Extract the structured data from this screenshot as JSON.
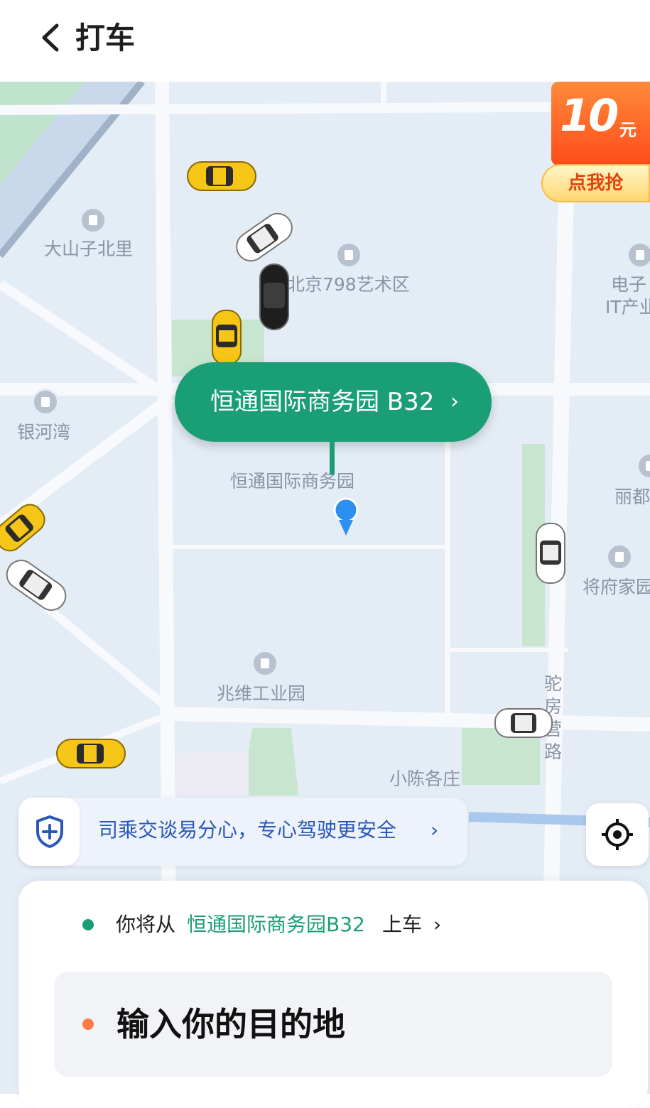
{
  "header": {
    "title": "打车",
    "back_icon": "chevron-left-icon"
  },
  "map": {
    "pois": [
      {
        "label": "大山子北里"
      },
      {
        "label": "北京798艺术区"
      },
      {
        "label": "电子"
      },
      {
        "label": "IT产业"
      },
      {
        "label": "银河湾"
      },
      {
        "label": "恒通国际商务园"
      },
      {
        "label": "丽都"
      },
      {
        "label": "将府家园"
      },
      {
        "label": "兆维工业园"
      },
      {
        "label": "小陈各庄"
      },
      {
        "label": "驼房营路"
      }
    ]
  },
  "promo": {
    "amount": "10",
    "unit": "元",
    "button": "点我抢",
    "colors": {
      "top": "#ff4c1a",
      "button_text": "#e2430f"
    }
  },
  "pickup_bubble": {
    "label": "恒通国际商务园 B32",
    "arrow": "›"
  },
  "safety_banner": {
    "text": "司乘交谈易分心，专心驾驶更安全",
    "arrow": "›",
    "icon": "shield-plus-icon"
  },
  "locate_button": {
    "icon": "locate-crosshair-icon"
  },
  "panel": {
    "pickup_prefix": "你将从",
    "pickup_place": "恒通国际商务园B32",
    "pickup_suffix": "上车",
    "pickup_arrow": "›",
    "destination_placeholder": "输入你的目的地",
    "colors": {
      "pickup_dot": "#1a9e76",
      "destination_dot": "#ff7a45",
      "accent": "#1a9e76"
    }
  }
}
